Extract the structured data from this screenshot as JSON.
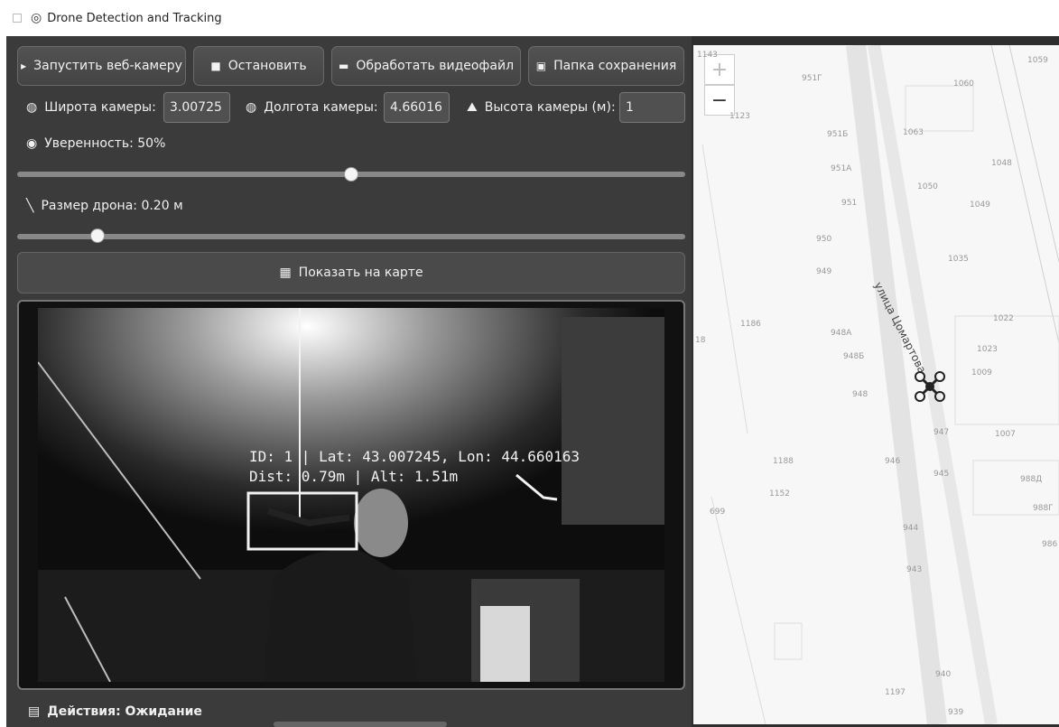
{
  "window": {
    "title": "Drone Detection and Tracking"
  },
  "toolbar": {
    "start_webcam": "Запустить веб-камеру",
    "stop": "Остановить",
    "process_video": "Обработать видеофайл",
    "save_folder": "Папка сохранения"
  },
  "camera": {
    "lat_label": "Широта камеры:",
    "lat_value": "3.00725",
    "lon_label": "Долгота камеры:",
    "lon_value": "4.66016",
    "height_label": "Высота камеры (м):",
    "height_value": "1"
  },
  "confidence": {
    "label": "Уверенность: 50%",
    "value": 0.5
  },
  "drone_size": {
    "label": "Размер дрона: 0.20 м",
    "value": 0.12
  },
  "show_map": "Показать на карте",
  "overlay": {
    "line1": "ID: 1 | Lat: 43.007245, Lon: 44.660163",
    "line2": "Dist: 0.79m | Alt: 1.51m"
  },
  "status": "Действия: Ожидание",
  "map": {
    "zoom_in": "+",
    "zoom_out": "−",
    "street": "улица Цомартова",
    "labels": [
      "1143",
      "951Г",
      "1060",
      "1059",
      "1123",
      "951Б",
      "1063",
      "951А",
      "1048",
      "1050",
      "951",
      "1049",
      "950",
      "1035",
      "949",
      "1186",
      "1022",
      "948А",
      "948Б",
      "1023",
      "1009",
      "948",
      "947",
      "1007",
      "1188",
      "946",
      "945",
      "988Д",
      "1152",
      "988Г",
      "699",
      "944",
      "943",
      "940",
      "1197",
      "939",
      "18",
      "986"
    ]
  },
  "icons": {
    "app": "target-icon",
    "play": "play-icon",
    "stop": "stop-icon",
    "folder": "folder-icon",
    "save": "floppy-icon",
    "globe": "globe-icon",
    "mountain": "mountain-icon",
    "target": "target-icon",
    "ruler": "ruler-icon",
    "map": "map-icon",
    "doc": "document-icon",
    "drone": "drone-marker-icon"
  }
}
